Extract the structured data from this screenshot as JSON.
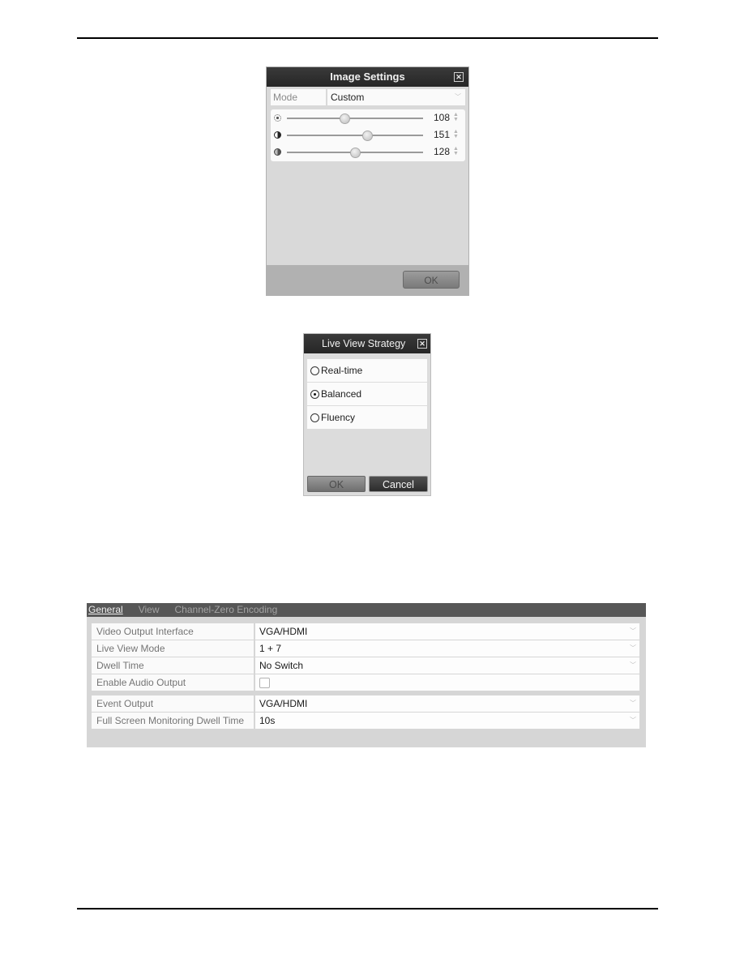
{
  "image_settings": {
    "title": "Image Settings",
    "close_icon": "close-icon",
    "mode_label": "Mode",
    "mode_value": "Custom",
    "sliders": [
      {
        "name": "brightness",
        "icon": "brightness-icon",
        "value": "108",
        "fraction": 0.42
      },
      {
        "name": "contrast",
        "icon": "contrast-icon",
        "value": "151",
        "fraction": 0.59
      },
      {
        "name": "saturation",
        "icon": "saturation-icon",
        "value": "128",
        "fraction": 0.5
      }
    ],
    "ok_label": "OK"
  },
  "live_view_strategy": {
    "title": "Live View Strategy",
    "options": [
      {
        "label": "Real-time",
        "selected": false
      },
      {
        "label": "Balanced",
        "selected": true
      },
      {
        "label": "Fluency",
        "selected": false
      }
    ],
    "ok_label": "OK",
    "cancel_label": "Cancel"
  },
  "general": {
    "tabs": [
      {
        "label": "General",
        "active": true
      },
      {
        "label": "View",
        "active": false
      },
      {
        "label": "Channel-Zero Encoding",
        "active": false
      }
    ],
    "group1": [
      {
        "label": "Video Output Interface",
        "value": "VGA/HDMI",
        "type": "select"
      },
      {
        "label": "Live View Mode",
        "value": "1 + 7",
        "type": "select"
      },
      {
        "label": "Dwell Time",
        "value": "No Switch",
        "type": "select"
      },
      {
        "label": "Enable Audio Output",
        "value": "",
        "type": "checkbox",
        "checked": false
      }
    ],
    "group2": [
      {
        "label": "Event Output",
        "value": "VGA/HDMI",
        "type": "select"
      },
      {
        "label": "Full Screen Monitoring Dwell Time",
        "value": "10s",
        "type": "select"
      }
    ]
  }
}
